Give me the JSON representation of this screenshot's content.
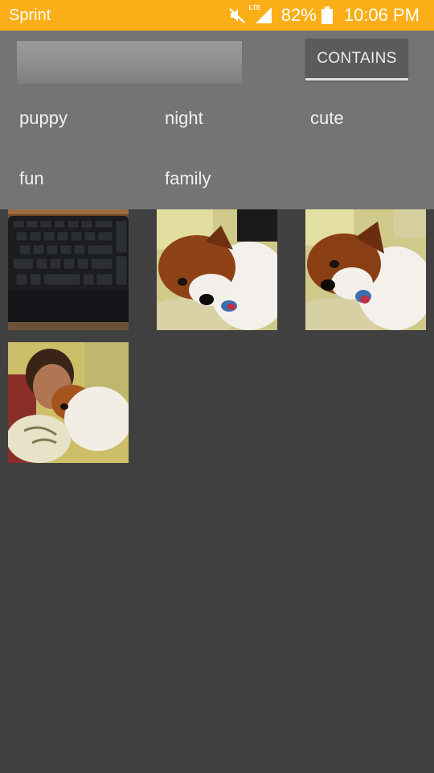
{
  "status_bar": {
    "carrier": "Sprint",
    "network_badge": "LTE",
    "battery_percent": "82%",
    "time": "10:06 PM",
    "icons": [
      "mute-icon",
      "signal-icon",
      "battery-icon"
    ],
    "background_color": "#FBAE17"
  },
  "filter": {
    "search_value": "",
    "contains_label": "CONTAINS",
    "tags": [
      "puppy",
      "night",
      "cute",
      "fun",
      "family"
    ]
  },
  "photos": [
    {
      "subject": "keyboard"
    },
    {
      "subject": "dog"
    },
    {
      "subject": "dog"
    },
    {
      "subject": "person-with-dog"
    }
  ],
  "colors": {
    "page_background": "#404040",
    "panel_background": "#747474",
    "button_background": "#5B5B5B"
  }
}
